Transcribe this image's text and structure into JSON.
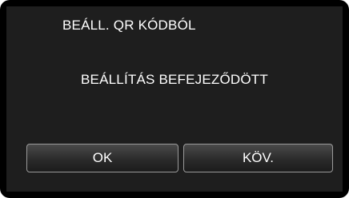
{
  "dialog": {
    "title": "BEÁLL. QR KÓDBÓL",
    "message": "BEÁLLÍTÁS BEFEJEZŐDÖTT"
  },
  "buttons": {
    "ok_label": "OK",
    "next_label": "KÖV."
  }
}
